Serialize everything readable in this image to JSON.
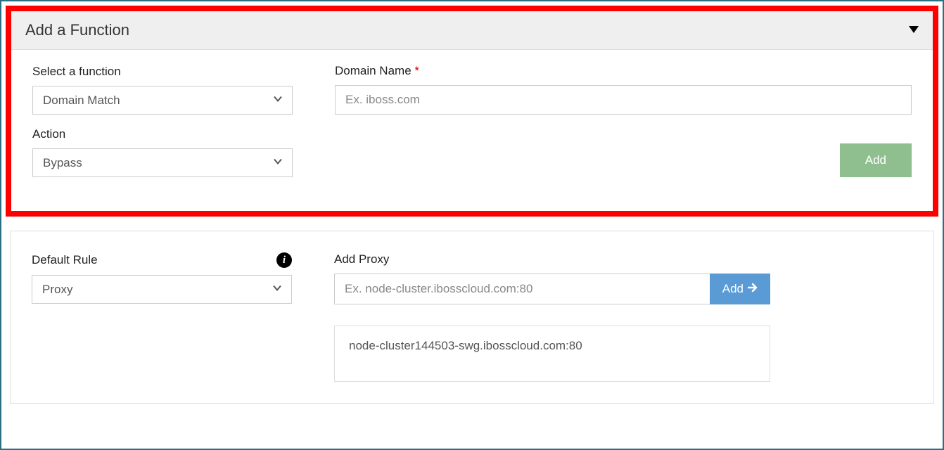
{
  "addFunction": {
    "title": "Add a Function",
    "selectFunction": {
      "label": "Select a function",
      "value": "Domain Match"
    },
    "domainName": {
      "label": "Domain Name",
      "requiredMark": "*",
      "placeholder": "Ex. iboss.com",
      "value": ""
    },
    "action": {
      "label": "Action",
      "value": "Bypass"
    },
    "addButton": "Add"
  },
  "defaultRule": {
    "label": "Default Rule",
    "value": "Proxy"
  },
  "addProxy": {
    "label": "Add Proxy",
    "placeholder": "Ex. node-cluster.ibosscloud.com:80",
    "value": "",
    "addButton": "Add"
  },
  "proxyList": {
    "items": [
      "node-cluster144503-swg.ibosscloud.com:80"
    ]
  }
}
